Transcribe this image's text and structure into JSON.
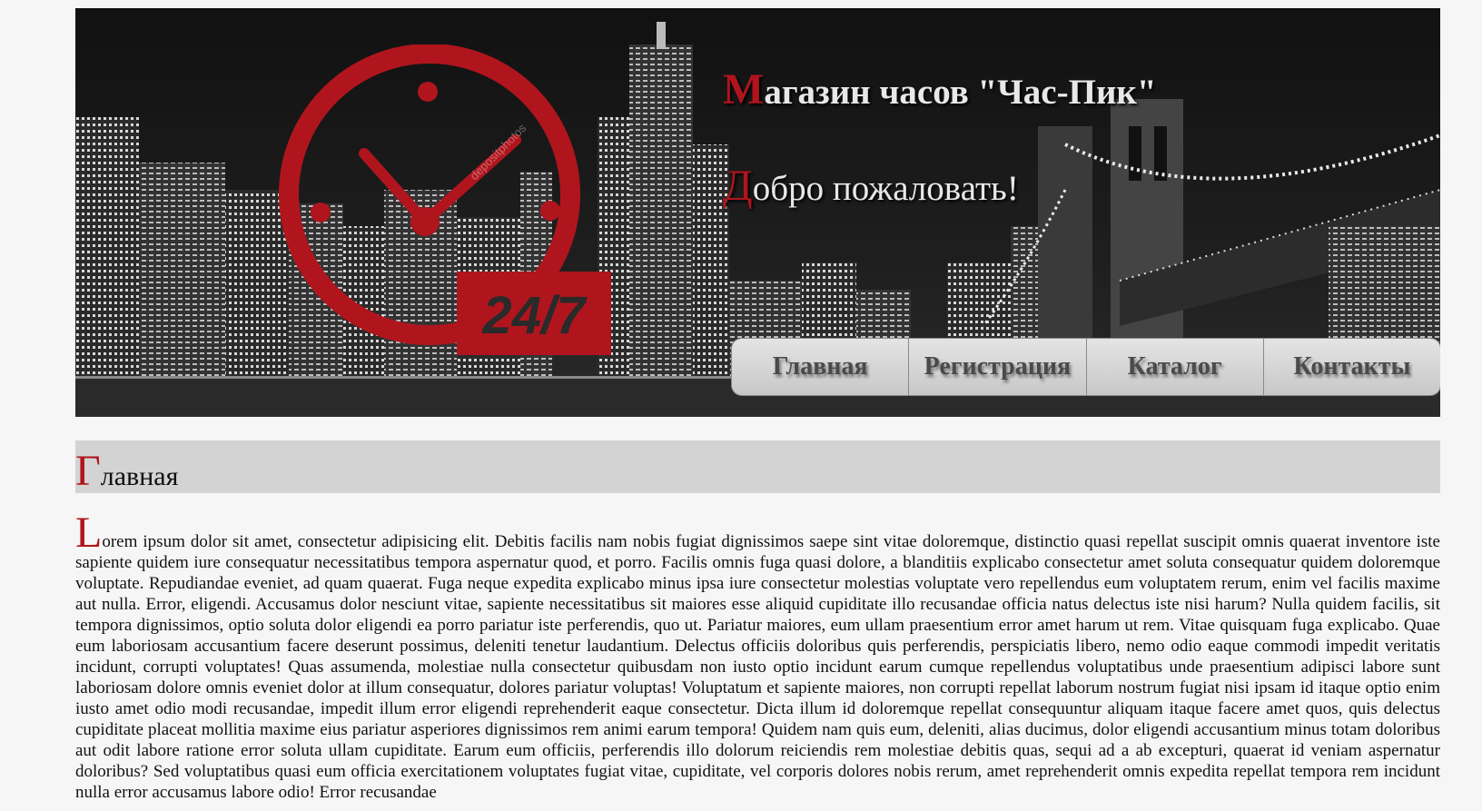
{
  "header": {
    "title_cap": "М",
    "title_rest": "агазин часов \"Час-Пик\"",
    "welcome_cap": "Д",
    "welcome_rest": "обро пожаловать!",
    "logo_badge": "24/7",
    "logo_watermark": "depositphotos"
  },
  "nav": {
    "items": [
      {
        "label": "Главная"
      },
      {
        "label": "Регистрация"
      },
      {
        "label": "Каталог"
      },
      {
        "label": "Контакты"
      }
    ]
  },
  "section": {
    "title_cap": "Г",
    "title_rest": "лавная"
  },
  "content": {
    "cap": "L",
    "text": "orem ipsum dolor sit amet, consectetur adipisicing elit. Debitis facilis nam nobis fugiat dignissimos saepe sint vitae doloremque, distinctio quasi repellat suscipit omnis quaerat inventore iste sapiente quidem iure consequatur necessitatibus tempora aspernatur quod, et porro. Facilis omnis fuga quasi dolore, a blanditiis explicabo consectetur amet soluta consequatur quidem doloremque voluptate. Repudiandae eveniet, ad quam quaerat. Fuga neque expedita explicabo minus ipsa iure consectetur molestias voluptate vero repellendus eum voluptatem rerum, enim vel facilis maxime aut nulla. Error, eligendi. Accusamus dolor nesciunt vitae, sapiente necessitatibus sit maiores esse aliquid cupiditate illo recusandae officia natus delectus iste nisi harum? Nulla quidem facilis, sit tempora dignissimos, optio soluta dolor eligendi ea porro pariatur iste perferendis, quo ut. Pariatur maiores, eum ullam praesentium error amet harum ut rem. Vitae quisquam fuga explicabo. Quae eum laboriosam accusantium facere deserunt possimus, deleniti tenetur laudantium. Delectus officiis doloribus quis perferendis, perspiciatis libero, nemo odio eaque commodi impedit veritatis incidunt, corrupti voluptates! Quas assumenda, molestiae nulla consectetur quibusdam non iusto optio incidunt earum cumque repellendus voluptatibus unde praesentium adipisci labore sunt laboriosam dolore omnis eveniet dolor at illum consequatur, dolores pariatur voluptas! Voluptatum et sapiente maiores, non corrupti repellat laborum nostrum fugiat nisi ipsam id itaque optio enim iusto amet odio modi recusandae, impedit illum error eligendi reprehenderit eaque consectetur. Dicta illum id doloremque repellat consequuntur aliquam itaque facere amet quos, quis delectus cupiditate placeat mollitia maxime eius pariatur asperiores dignissimos rem animi earum tempora! Quidem nam quis eum, deleniti, alias ducimus, dolor eligendi accusantium minus totam doloribus aut odit labore ratione error soluta ullam cupiditate. Earum eum officiis, perferendis illo dolorum reiciendis rem molestiae debitis quas, sequi ad a ab excepturi, quaerat id veniam aspernatur doloribus? Sed voluptatibus quasi eum officia exercitationem voluptates fugiat vitae, cupiditate, vel corporis dolores nobis rerum, amet reprehenderit omnis expedita repellat tempora rem incidunt nulla error accusamus labore odio! Error recusandae"
  },
  "colors": {
    "accent": "#b0151d",
    "page_bg": "#f6f6f6",
    "section_bar": "#d3d3d3",
    "nav_text": "#4a4a4a"
  }
}
